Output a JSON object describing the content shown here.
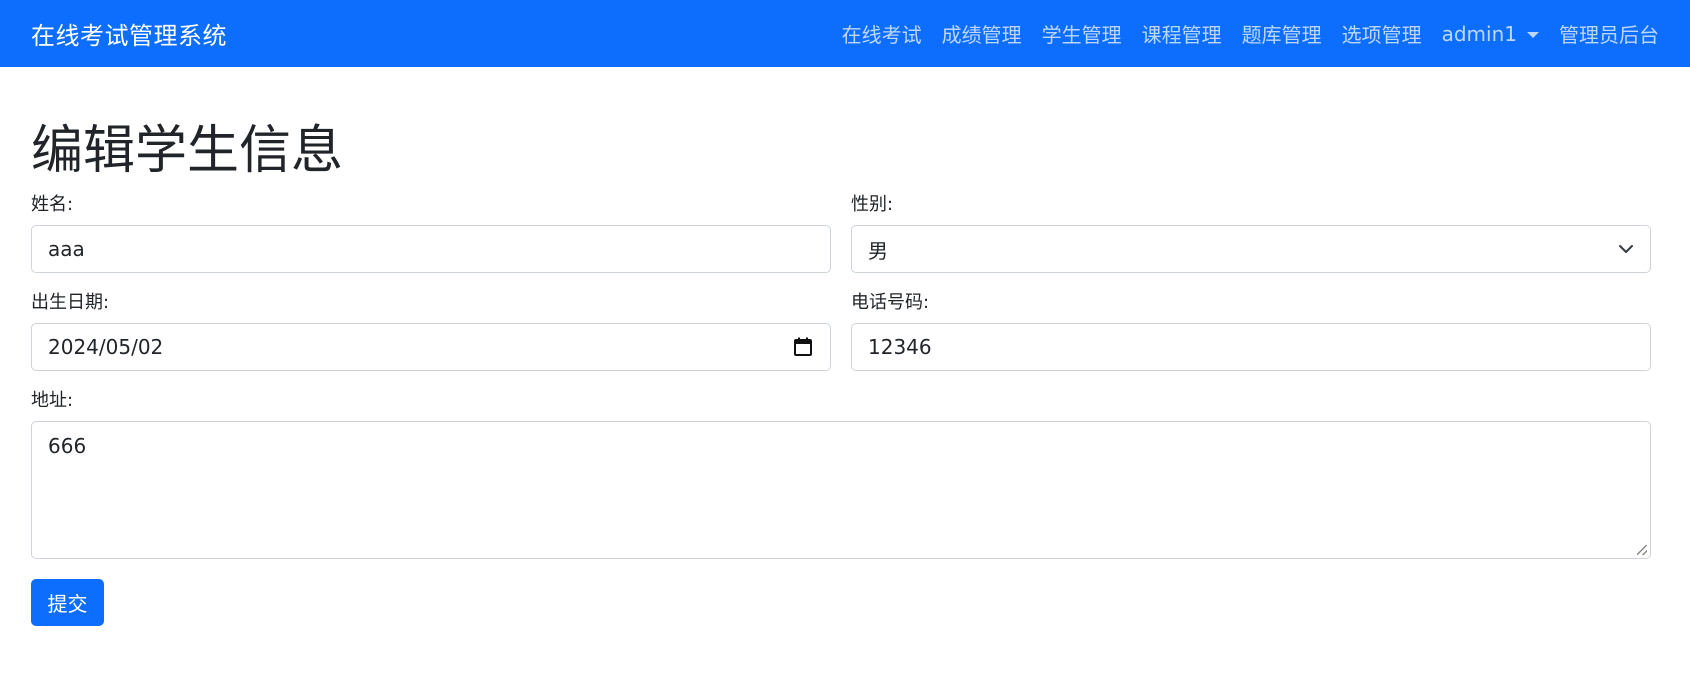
{
  "navbar": {
    "brand": "在线考试管理系统",
    "items": [
      {
        "label": "在线考试"
      },
      {
        "label": "成绩管理"
      },
      {
        "label": "学生管理"
      },
      {
        "label": "课程管理"
      },
      {
        "label": "题库管理"
      },
      {
        "label": "选项管理"
      },
      {
        "label": "admin1"
      },
      {
        "label": "管理员后台"
      }
    ],
    "bg_color": "#0d6efd",
    "link_color": "rgba(255,255,255,0.72)",
    "caret_icon": "caret-down-icon"
  },
  "page": {
    "title": "编辑学生信息"
  },
  "form": {
    "name": {
      "label": "姓名:",
      "value": "aaa"
    },
    "gender": {
      "label": "性别:",
      "value": "男",
      "icon": "chevron-down-icon"
    },
    "birth": {
      "label": "出生日期:",
      "value": "2024/05/02",
      "icon": "calendar-icon"
    },
    "phone": {
      "label": "电话号码:",
      "value": "12346"
    },
    "address": {
      "label": "地址:",
      "value": "666"
    },
    "submit": {
      "label": "提交",
      "color": "#0d6efd"
    }
  }
}
